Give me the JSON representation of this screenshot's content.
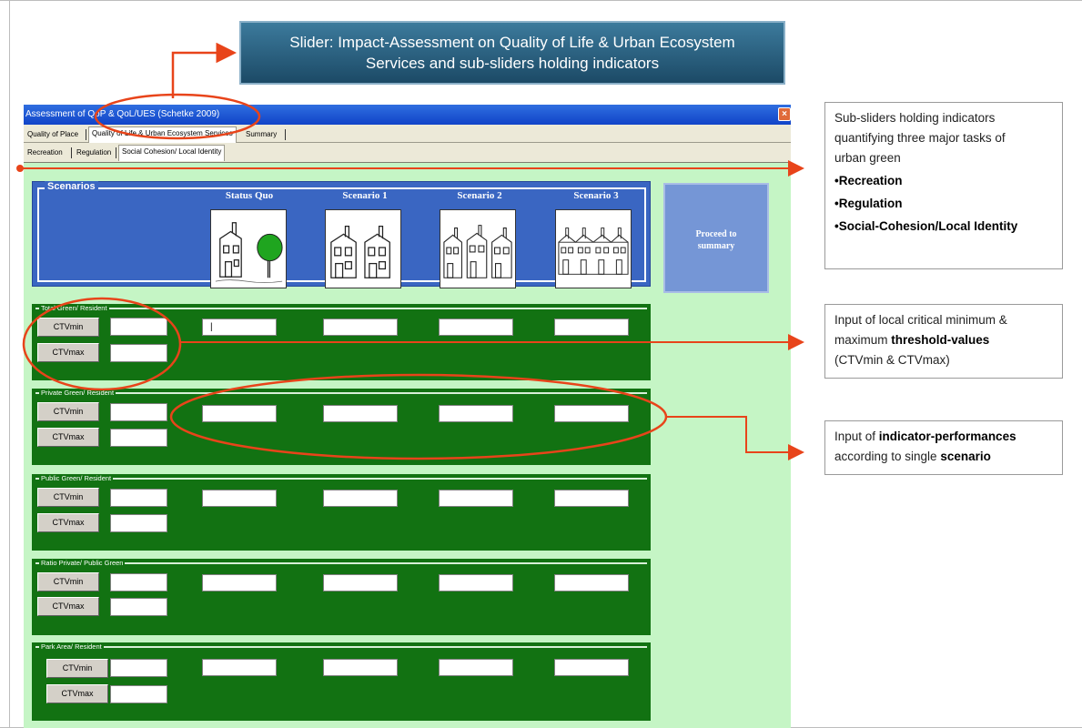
{
  "banner": {
    "line1": "Slider: Impact-Assessment on Quality of  Life & Urban Ecosystem",
    "line2": "Services and sub-sliders holding indicators"
  },
  "window": {
    "title_prefix": "Assessment of ",
    "title_main": "QoP & QoL/UES (Schetke 2009)",
    "close_label": "×",
    "tabs_main": [
      "Quality of Place",
      "Quality of Life & Urban Ecosystem Services",
      "Summary"
    ],
    "tabs_sub": [
      "Recreation",
      "Regulation",
      "Social Cohesion/ Local Identity"
    ]
  },
  "scenarios": {
    "group_label": "Scenarios",
    "labels": [
      "Status Quo",
      "Scenario 1",
      "Scenario 2",
      "Scenario 3"
    ],
    "images": [
      "house-tree-sketch",
      "two-houses-sketch",
      "three-houses-sketch",
      "row-houses-sketch"
    ]
  },
  "proceed_button": {
    "line1": "Proceed to",
    "line2": "summary"
  },
  "indicators": [
    {
      "title": "Total Green/ Resident",
      "min_label": "CTVmin",
      "max_label": "CTVmax",
      "first_scenario_value": "|"
    },
    {
      "title": "Private Green/ Resident",
      "min_label": "CTVmin",
      "max_label": "CTVmax",
      "first_scenario_value": ""
    },
    {
      "title": "Public Green/ Resident",
      "min_label": "CTVmin",
      "max_label": "CTVmax",
      "first_scenario_value": ""
    },
    {
      "title": "Ratio Private/ Public Green",
      "min_label": "CTVmin",
      "max_label": "CTVmax",
      "first_scenario_value": ""
    },
    {
      "title": "Park Area/ Resident",
      "min_label": "CTVmin",
      "max_label": "CTVmax",
      "first_scenario_value": ""
    }
  ],
  "notes": {
    "subsliders": {
      "text1": "Sub-sliders holding indicators",
      "text2": "quantifying three major tasks of",
      "text3": "urban green",
      "bullet1": "•Recreation",
      "bullet2": "•Regulation",
      "bullet3": "•Social-Cohesion/Local Identity"
    },
    "threshold": {
      "text1": "Input of local critical minimum &",
      "text2": "maximum ",
      "bold": "threshold-values",
      "text3": "(CTVmin & CTVmax)"
    },
    "performance": {
      "text1": "Input of ",
      "bold1": "indicator-performances",
      "text2": "according to single ",
      "bold2": "scenario"
    }
  },
  "colors": {
    "annotation_red": "#e8441a",
    "panel_green": "#127212",
    "panel_blue": "#3a66c2",
    "client_bg": "#c5f5c5"
  }
}
